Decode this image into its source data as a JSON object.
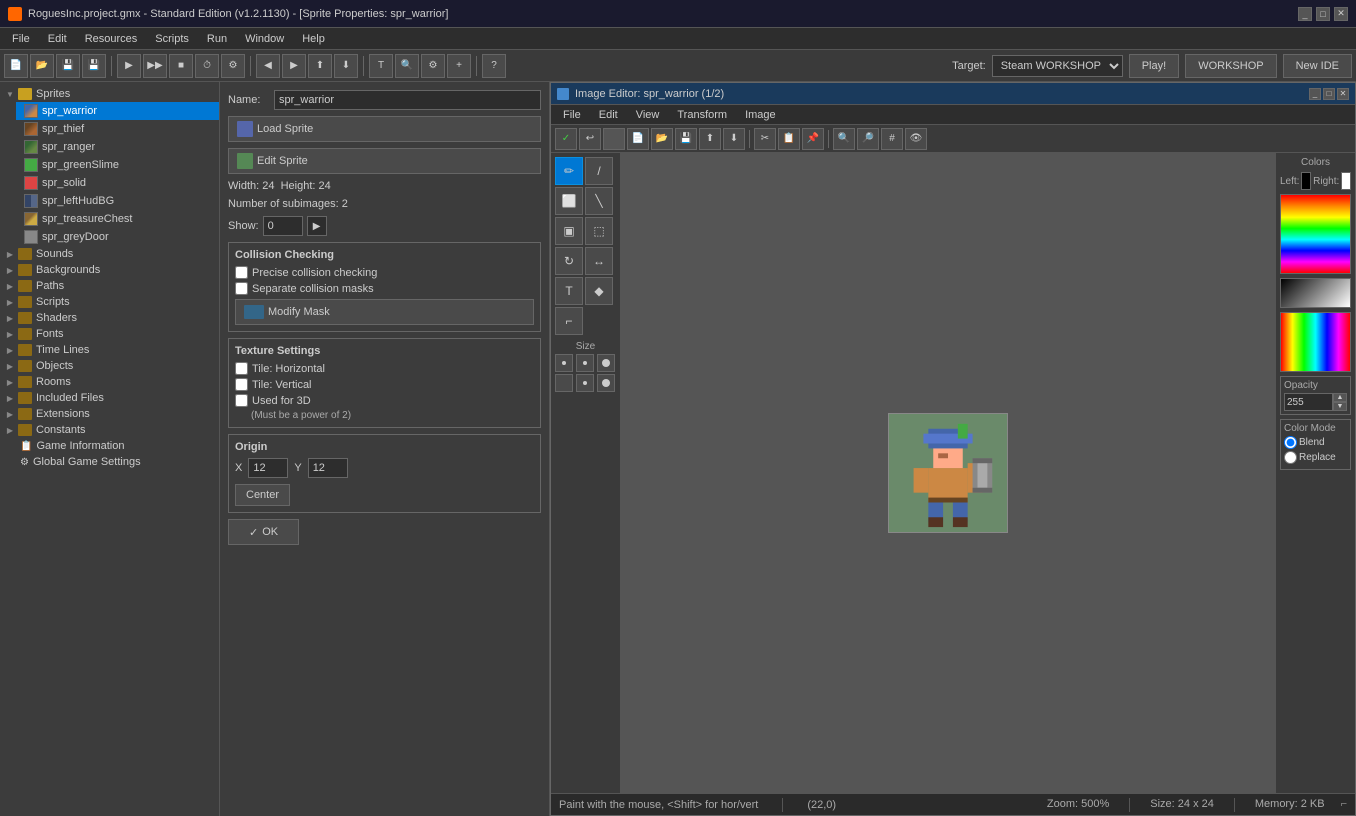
{
  "titlebar": {
    "title": "RoguesInc.project.gmx  -  Standard Edition (v1.2.1130) - [Sprite Properties: spr_warrior]",
    "icon": "game-maker-icon"
  },
  "menubar": {
    "items": [
      "File",
      "Edit",
      "Resources",
      "Scripts",
      "Run",
      "Window",
      "Help"
    ]
  },
  "toolbar": {
    "target_label": "Target:",
    "target_value": "Steam WORKSHOP",
    "play_label": "Play!",
    "workshop_label": "WORKSHOP",
    "new_ide_label": "New IDE"
  },
  "sidebar": {
    "groups": [
      {
        "name": "Sprites",
        "expanded": true,
        "items": [
          {
            "name": "spr_warrior",
            "selected": true
          },
          {
            "name": "spr_thief"
          },
          {
            "name": "spr_ranger"
          },
          {
            "name": "spr_greenSlime"
          },
          {
            "name": "spr_solid"
          },
          {
            "name": "spr_leftHudBG"
          },
          {
            "name": "spr_treasureChest"
          },
          {
            "name": "spr_greyDoor"
          }
        ]
      },
      {
        "name": "Sounds",
        "expanded": false,
        "items": []
      },
      {
        "name": "Backgrounds",
        "expanded": false,
        "items": []
      },
      {
        "name": "Paths",
        "expanded": false,
        "items": []
      },
      {
        "name": "Scripts",
        "expanded": false,
        "items": []
      },
      {
        "name": "Shaders",
        "expanded": false,
        "items": []
      },
      {
        "name": "Fonts",
        "expanded": false,
        "items": []
      },
      {
        "name": "Time Lines",
        "expanded": false,
        "items": []
      },
      {
        "name": "Objects",
        "expanded": false,
        "items": []
      },
      {
        "name": "Rooms",
        "expanded": false,
        "items": []
      },
      {
        "name": "Included Files",
        "expanded": false,
        "items": []
      },
      {
        "name": "Extensions",
        "expanded": false,
        "items": []
      },
      {
        "name": "Constants",
        "expanded": false,
        "items": []
      }
    ],
    "standalone_items": [
      {
        "name": "Game Information"
      },
      {
        "name": "Global Game Settings"
      }
    ]
  },
  "sprite_props": {
    "name_label": "Name:",
    "name_value": "spr_warrior",
    "load_sprite_label": "Load Sprite",
    "edit_sprite_label": "Edit Sprite",
    "width_label": "Width:",
    "width_value": "24",
    "height_label": "Height:",
    "height_value": "24",
    "subimages_label": "Number of subimages:",
    "subimages_value": "2",
    "show_label": "Show:",
    "show_value": "0",
    "origin_label": "Origin",
    "x_label": "X",
    "x_value": "12",
    "y_label": "Y",
    "y_value": "12",
    "center_label": "Center",
    "ok_label": "OK",
    "collision": {
      "title": "Collision Checking",
      "precise_label": "Precise collision checking",
      "separate_label": "Separate collision masks",
      "modify_mask_label": "Modify Mask"
    },
    "texture": {
      "title": "Texture Settings",
      "tile_h_label": "Tile: Horizontal",
      "tile_v_label": "Tile: Vertical",
      "used_3d_label": "Used for 3D",
      "power_note": "(Must be a power of 2)"
    }
  },
  "image_editor": {
    "title": "Image Editor: spr_warrior (1/2)",
    "menu_items": [
      "File",
      "Edit",
      "View",
      "Transform",
      "Image"
    ],
    "status_text": "Paint with the mouse, <Shift> for hor/vert",
    "coords": "(22,0)",
    "zoom": "Zoom: 500%",
    "size": "Size: 24 x 24",
    "memory": "Memory: 2 KB"
  },
  "colors_panel": {
    "title": "Colors",
    "left_label": "Left:",
    "right_label": "Right:",
    "opacity_title": "Opacity",
    "opacity_value": "255",
    "color_mode_title": "Color Mode",
    "blend_label": "Blend",
    "replace_label": "Replace"
  },
  "tools": {
    "pencil": "✏",
    "line": "/",
    "eraser": "⬜",
    "fill": "▣",
    "select": "⬚",
    "rotate": "↻",
    "text": "T",
    "diamond": "◆",
    "corner": "⌐"
  },
  "size_label": "Size"
}
